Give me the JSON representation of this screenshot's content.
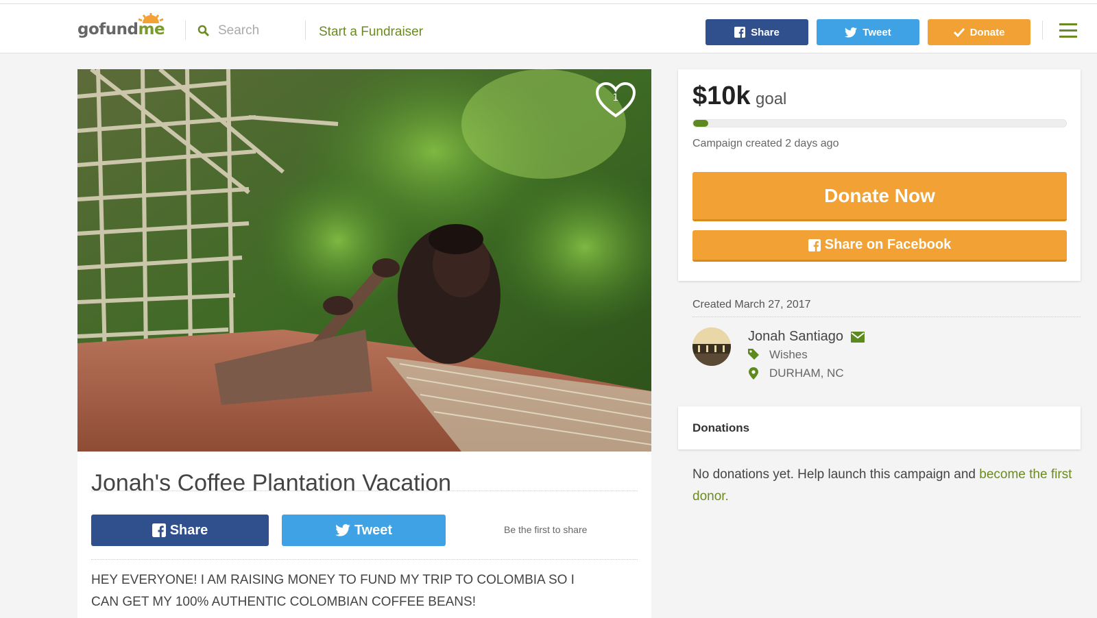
{
  "header": {
    "logo_part1": "gofund",
    "logo_part2": "me",
    "search_placeholder": "Search",
    "start_link": "Start a Fundraiser",
    "share_label": "Share",
    "tweet_label": "Tweet",
    "donate_label": "Donate"
  },
  "campaign": {
    "title": "Jonah's Coffee Plantation Vacation",
    "heart_count": "1",
    "share_label": "Share",
    "tweet_label": "Tweet",
    "first_to_share": "Be the first to share",
    "story_line1": "HEY EVERYONE! I AM RAISING MONEY TO FUND MY TRIP TO COLOMBIA SO I",
    "story_line2": "CAN GET MY 100% AUTHENTIC COLOMBIAN COFFEE BEANS!"
  },
  "goal": {
    "amount": "$10k",
    "word": "goal",
    "progress_fraction": 0.04,
    "created_ago": "Campaign created 2 days ago",
    "donate_now": "Donate Now",
    "share_facebook": "Share on Facebook"
  },
  "organizer": {
    "created_date": "Created March 27, 2017",
    "name": "Jonah Santiago",
    "category": "Wishes",
    "location": "DURHAM, NC"
  },
  "donations": {
    "title": "Donations",
    "empty_text": "No donations yet. Help launch this campaign and ",
    "empty_link": "become the first donor."
  },
  "colors": {
    "brand_green": "#6b8a22",
    "facebook_blue": "#2f4f8d",
    "twitter_blue": "#3ea2e4",
    "donate_orange": "#f2a234"
  },
  "icons": [
    "search-icon",
    "facebook-icon",
    "twitter-icon",
    "check-icon",
    "hamburger-icon",
    "heart-icon",
    "mail-icon",
    "tag-icon",
    "map-pin-icon"
  ]
}
